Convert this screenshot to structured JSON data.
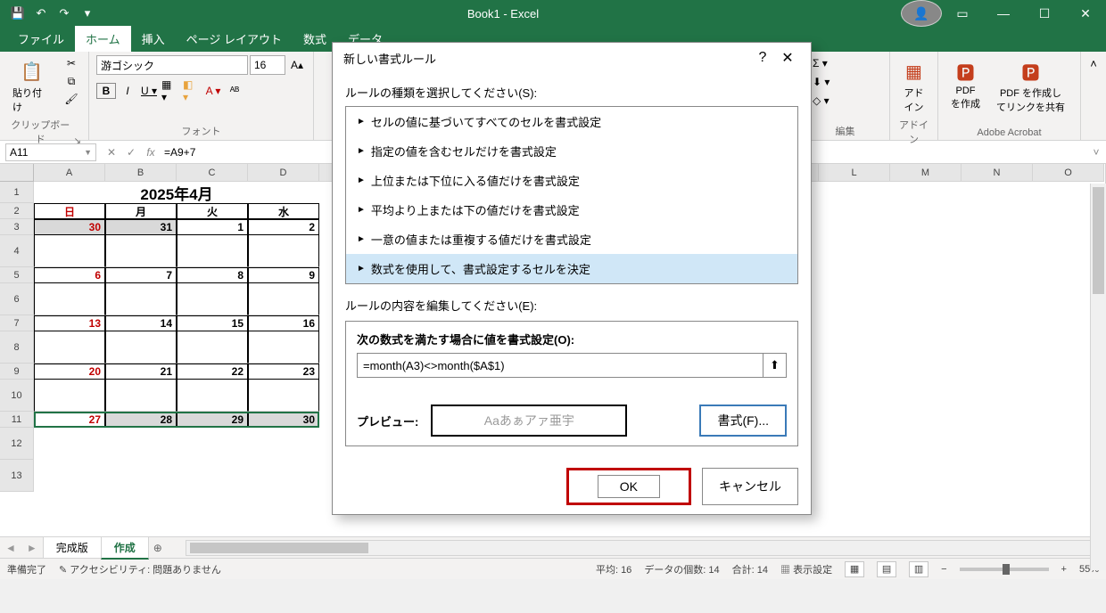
{
  "titlebar": {
    "title": "Book1  -  Excel"
  },
  "ribbon_tabs": [
    "ファイル",
    "ホーム",
    "挿入",
    "ページ レイアウト",
    "数式",
    "データ"
  ],
  "ribbon_tabs_right_cut": [
    "入",
    "式"
  ],
  "ribbon": {
    "clipboard": {
      "paste": "貼り付け",
      "label": "クリップボード"
    },
    "font": {
      "name": "游ゴシック",
      "size": "16",
      "label": "フォント"
    },
    "editing": {
      "label": "編集"
    },
    "addin": {
      "label": "アドイン",
      "btn": "アド\nイン"
    },
    "acrobat": {
      "label": "Adobe Acrobat",
      "pdf1": "PDF\nを作成",
      "pdf2": "PDF を作成し\nてリンクを共有"
    }
  },
  "formula_bar": {
    "name_box": "A11",
    "formula": "=A9+7"
  },
  "columns": [
    "A",
    "B",
    "C",
    "D",
    "",
    "",
    "",
    "",
    "",
    "",
    "",
    "L",
    "M",
    "N",
    "O"
  ],
  "rows": [
    "1",
    "2",
    "3",
    "4",
    "5",
    "6",
    "7",
    "8",
    "9",
    "10",
    "11",
    "12",
    "13"
  ],
  "calendar": {
    "title": "2025年4月",
    "days": [
      "日",
      "月",
      "火",
      "水"
    ],
    "grid": [
      [
        "30",
        "31",
        "1",
        "2"
      ],
      [
        "",
        "",
        "",
        ""
      ],
      [
        "6",
        "7",
        "8",
        "9"
      ],
      [
        "",
        "",
        "",
        ""
      ],
      [
        "13",
        "14",
        "15",
        "16"
      ],
      [
        "",
        "",
        "",
        ""
      ],
      [
        "20",
        "21",
        "22",
        "23"
      ],
      [
        "",
        "",
        "",
        ""
      ],
      [
        "27",
        "28",
        "29",
        "30"
      ]
    ]
  },
  "sheet_tabs": {
    "tabs": [
      "完成版",
      "作成"
    ],
    "active": 1
  },
  "status": {
    "ready": "準備完了",
    "acc": "アクセシビリティ: 問題ありません",
    "avg": "平均: 16",
    "count": "データの個数: 14",
    "sum": "合計: 14",
    "display": "表示設定",
    "zoom": "55%"
  },
  "dialog": {
    "title": "新しい書式ルール",
    "select_rule_label": "ルールの種類を選択してください(S):",
    "rules": [
      "セルの値に基づいてすべてのセルを書式設定",
      "指定の値を含むセルだけを書式設定",
      "上位または下位に入る値だけを書式設定",
      "平均より上または下の値だけを書式設定",
      "一意の値または重複する値だけを書式設定",
      "数式を使用して、書式設定するセルを決定"
    ],
    "edit_label": "ルールの内容を編集してください(E):",
    "formula_label": "次の数式を満たす場合に値を書式設定(O):",
    "formula_value": "=month(A3)<>month($A$1)",
    "preview_label": "プレビュー:",
    "preview_text": "Aaあぁアァ亜宇",
    "format_btn": "書式(F)...",
    "ok": "OK",
    "cancel": "キャンセル"
  }
}
